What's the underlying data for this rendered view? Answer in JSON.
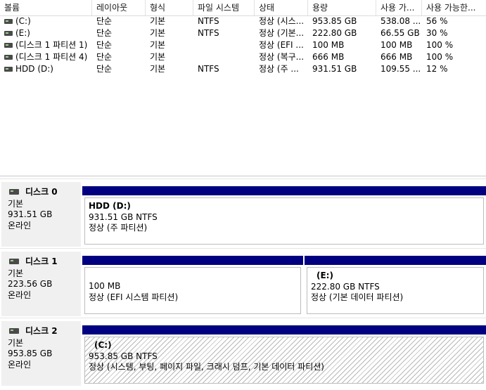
{
  "columns": [
    "볼륨",
    "레이아웃",
    "형식",
    "파일 시스템",
    "상태",
    "용량",
    "사용 가...",
    "사용 가능한..."
  ],
  "volumes": [
    {
      "name": "(C:)",
      "layout": "단순",
      "type": "기본",
      "fs": "NTFS",
      "status": "정상 (시스...",
      "capacity": "953.85 GB",
      "free": "538.08 ...",
      "pct": "56 %"
    },
    {
      "name": "(E:)",
      "layout": "단순",
      "type": "기본",
      "fs": "NTFS",
      "status": "정상 (기본...",
      "capacity": "222.80 GB",
      "free": "66.55 GB",
      "pct": "30 %"
    },
    {
      "name": "(디스크 1 파티션 1)",
      "layout": "단순",
      "type": "기본",
      "fs": "",
      "status": "정상 (EFI ...",
      "capacity": "100 MB",
      "free": "100 MB",
      "pct": "100 %"
    },
    {
      "name": "(디스크 1 파티션 4)",
      "layout": "단순",
      "type": "기본",
      "fs": "",
      "status": "정상 (복구...",
      "capacity": "666 MB",
      "free": "666 MB",
      "pct": "100 %"
    },
    {
      "name": "HDD (D:)",
      "layout": "단순",
      "type": "기본",
      "fs": "NTFS",
      "status": "정상 (주 ...",
      "capacity": "931.51 GB",
      "free": "109.55 ...",
      "pct": "12 %"
    }
  ],
  "disks": [
    {
      "title": "디스크 0",
      "type": "기본",
      "size": "931.51 GB",
      "state": "온라인",
      "partitions": [
        {
          "name": "HDD  (D:)",
          "size": "931.51 GB NTFS",
          "status": "정상 (주 파티션)"
        }
      ]
    },
    {
      "title": "디스크 1",
      "type": "기본",
      "size": "223.56 GB",
      "state": "온라인",
      "partitions": [
        {
          "name": "",
          "size": "100 MB",
          "status": "정상 (EFI 시스템 파티션)"
        },
        {
          "name": "(E:)",
          "size": "222.80 GB NTFS",
          "status": "정상 (기본 데이터 파티션)"
        }
      ]
    },
    {
      "title": "디스크 2",
      "type": "기본",
      "size": "953.85 GB",
      "state": "온라인",
      "partitions": [
        {
          "name": "(C:)",
          "size": "953.85 GB NTFS",
          "status": "정상 (시스템, 부팅, 페이지 파일, 크래시 덤프, 기본 데이터 파티션)"
        }
      ]
    }
  ],
  "colors": {
    "partition_bar": "#000080",
    "label_bg": "#f0f0f0"
  }
}
